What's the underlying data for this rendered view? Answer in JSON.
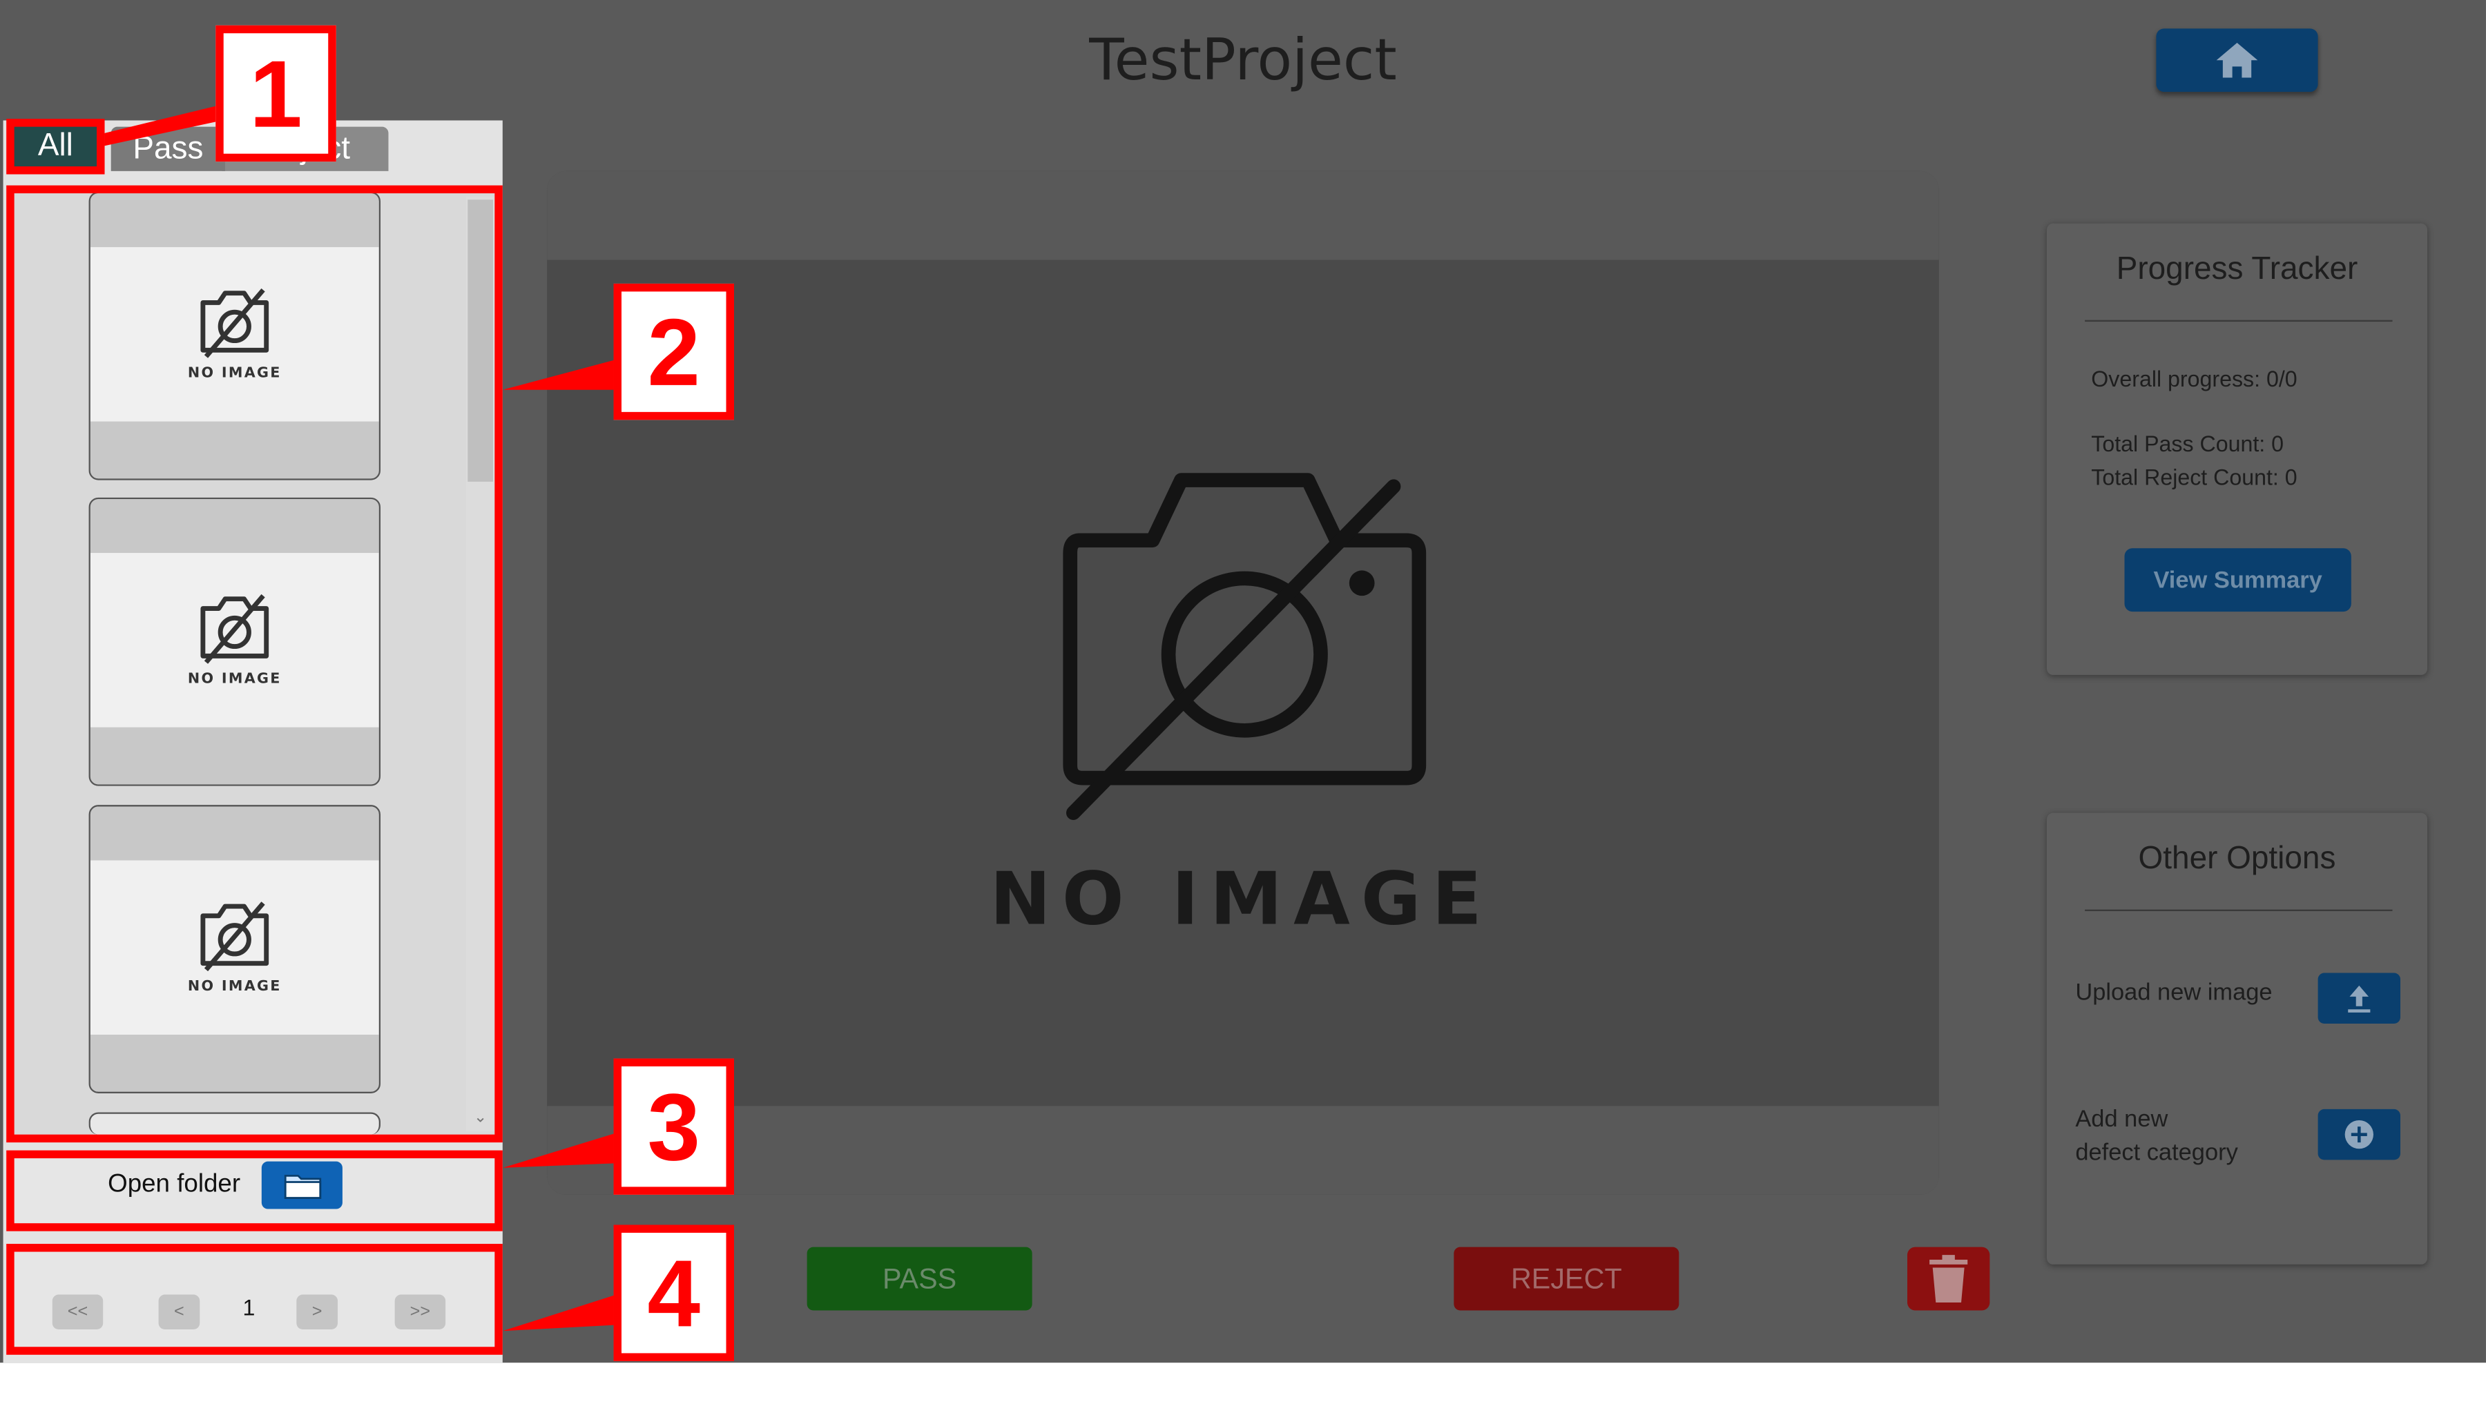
{
  "header": {
    "title": "TestProject",
    "home_icon": "home-icon"
  },
  "tabs": [
    {
      "label": "All",
      "active": true
    },
    {
      "label": "Pass",
      "active": false
    },
    {
      "label": "Reject",
      "active": false
    }
  ],
  "thumbnails": [
    {
      "caption": "NO IMAGE"
    },
    {
      "caption": "NO IMAGE"
    },
    {
      "caption": "NO IMAGE"
    }
  ],
  "folder": {
    "label": "Open folder",
    "icon": "folder-icon"
  },
  "pagination": {
    "first": "<<",
    "prev": "<",
    "page": "1",
    "next": ">",
    "last": ">>"
  },
  "viewer": {
    "caption": "NO IMAGE",
    "icon": "no-image-camera-icon"
  },
  "actions": {
    "pass": "PASS",
    "reject": "REJECT",
    "delete_icon": "trash-icon"
  },
  "progress": {
    "title": "Progress Tracker",
    "overall": "Overall progress: 0/0",
    "pass_count": "Total Pass Count: 0",
    "reject_count": "Total Reject Count: 0",
    "summary_button": "View Summary"
  },
  "options": {
    "title": "Other Options",
    "upload_label": "Upload new image",
    "add_label_line1": "Add new",
    "add_label_line2": "defect category"
  },
  "callouts": [
    "1",
    "2",
    "3",
    "4"
  ],
  "colors": {
    "accent": "#0a3f6e",
    "pass": "#135a13",
    "reject": "#7a0e0e",
    "highlight": "#ff0000"
  }
}
